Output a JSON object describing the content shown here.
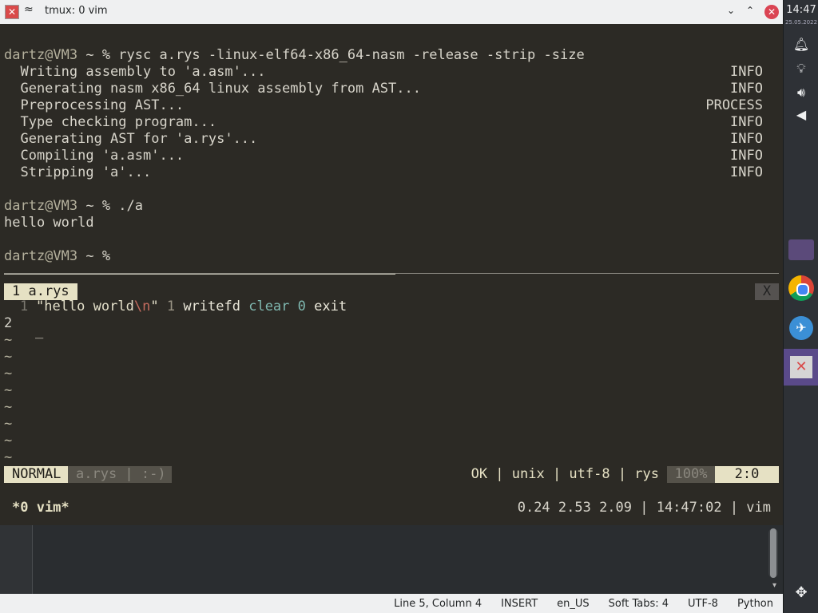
{
  "window": {
    "title": "tmux: 0 vim",
    "pin_glyph": "≈",
    "min_glyph": "⌄",
    "max_glyph": "⌃",
    "close_glyph": "✕",
    "app_glyph": "✕"
  },
  "terminal": {
    "lines": [
      {
        "user": "dartz@VM3",
        "rest": " ~ % rysc a.rys -linux-elf64-x86_64-nasm -release -strip -size"
      },
      {
        "text": "  Writing assembly to 'a.asm'...",
        "tag": "INFO"
      },
      {
        "text": "  Generating nasm x86_64 linux assembly from AST...",
        "tag": "INFO"
      },
      {
        "text": "  Preprocessing AST...",
        "tag": "PROCESS"
      },
      {
        "text": "  Type checking program...",
        "tag": "INFO"
      },
      {
        "text": "  Generating AST for 'a.rys'...",
        "tag": "INFO"
      },
      {
        "text": "  Compiling 'a.asm'...",
        "tag": "INFO"
      },
      {
        "text": "  Stripping 'a'...",
        "tag": "INFO"
      },
      {
        "user": "dartz@VM3",
        "rest": " ~ % ./a"
      },
      {
        "text": "hello world"
      },
      {
        "user": "dartz@VM3",
        "rest": " ~ %"
      }
    ]
  },
  "vim": {
    "tab_label": " 1 a.rys",
    "tab_close": "X",
    "line1_num": "1",
    "line1": {
      "str_open": "\"hello world",
      "esc": "\\n",
      "str_close": "\"",
      "num1": "1",
      "fn1": "writefd",
      "fn2": "clear",
      "num2": "0",
      "kw": "exit"
    },
    "line2_num": "2",
    "cursor": "_",
    "tilde": "~",
    "mode": "NORMAL",
    "fileinfo": "a.rys | :-)",
    "right_info": "OK | unix | utf-8 | rys",
    "percent": "100%",
    "position": "2:0"
  },
  "tmux": {
    "window": "*0 vim*",
    "right": "0.24 2.53 2.09 | 14:47:02 | vim"
  },
  "editor_status": {
    "position": "Line 5, Column 4",
    "mode": "INSERT",
    "locale": "en_US",
    "tabs": "Soft Tabs: 4",
    "encoding": "UTF-8",
    "language": "Python"
  },
  "panel": {
    "clock": "14:47",
    "date": "25.05.2022",
    "icons": [
      "bell-icon",
      "bulb-icon",
      "speaker-icon",
      "arrow-left-icon"
    ],
    "bottom_icon": "move-icon"
  }
}
